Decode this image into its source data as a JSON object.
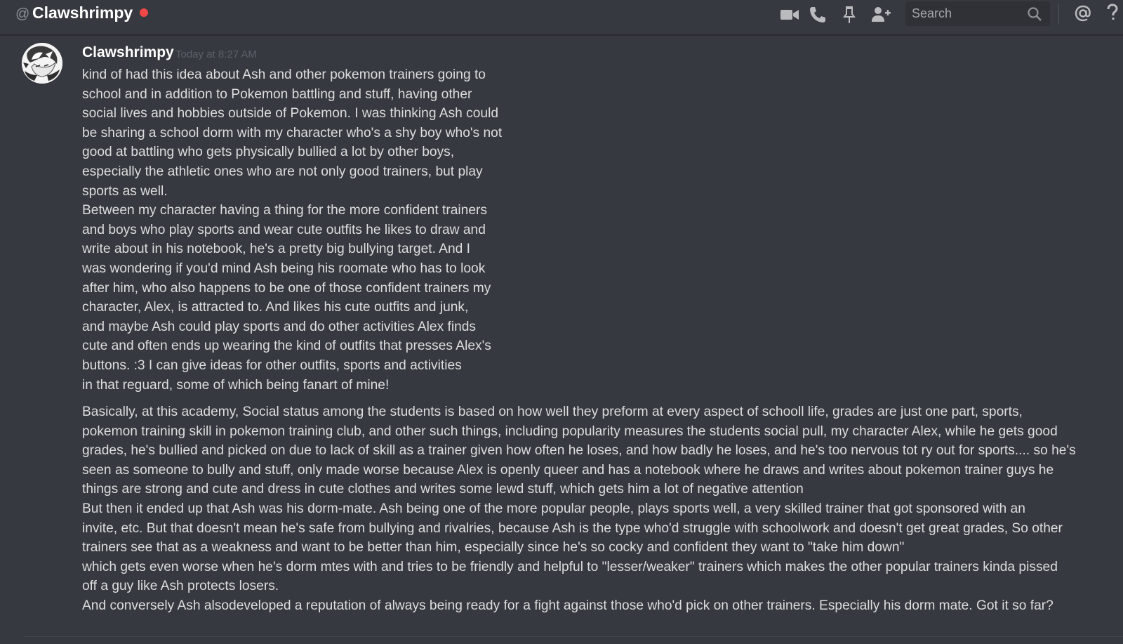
{
  "header": {
    "at_symbol": "@",
    "channel_name": "Clawshrimpy",
    "status_color": "#f04747",
    "toolbar_icons": [
      "video-call-icon",
      "voice-call-icon",
      "pin-icon",
      "add-friend-icon"
    ],
    "search": {
      "placeholder": "Search",
      "value": ""
    },
    "right_icons": [
      "mention-icon",
      "help-icon"
    ]
  },
  "message": {
    "author": "Clawshrimpy",
    "timestamp": "Today at 8:27 AM",
    "avatar": "avatar-image",
    "block1": [
      "kind of had this idea about Ash and other pokemon trainers going to",
      "school and in addition to Pokemon battling and stuff, having other",
      "social lives and hobbies outside of Pokemon. I was thinking Ash could",
      "be sharing a school dorm with my character who's a shy boy who's not",
      "good at battling who gets physically bullied a lot by other boys,",
      "especially the athletic ones who are not only good trainers, but play",
      "sports as well.",
      "Between my character having a thing for the more confident trainers",
      "and boys who play sports and wear cute outfits he likes to draw and",
      "write about in his notebook, he's a pretty big bullying target. And I",
      "was wondering if you'd mind Ash being his roomate who has to look",
      "after him, who also happens to be one of those confident trainers my",
      "character, Alex, is attracted to. And likes his cute outfits and junk,",
      "and maybe Ash could play sports and do other activities Alex finds",
      "cute and often ends up wearing the kind of outfits that presses Alex's",
      "buttons. :3 I can give ideas for other outfits, sports and activities",
      "in that reguard, some of which being fanart of mine!"
    ],
    "block2": [
      "Basically, at this academy, Social status among the students is based on how well they preform at every aspect of schooll life, grades are just one part, sports,",
      "pokemon training skill in pokemon training club, and other such things, including popularity measures the students social pull, my character Alex, while he gets good",
      "grades, he's bullied and picked on due to lack of skill as a trainer given how often he loses, and how badly he loses, and he's too nervous tot ry out for sports.... so he's",
      "seen as someone to bully and stuff, only made worse because Alex is openly queer and has a notebook where he draws and writes about pokemon trainer guys he",
      "things are strong and cute and dress in cute clothes and writes some lewd stuff, which gets him a lot of negative attention",
      "But then it ended up that Ash was his dorm-mate. Ash being one of the more popular people, plays sports well, a very skilled trainer that got sponsored with an",
      "invite, etc. But that doesn't mean he's safe from bullying and rivalries, because Ash is the type who'd struggle with schoolwork and doesn't get great grades, So other",
      "trainers see that as a weakness and want to be better than him, especially since he's so cocky and confident they want to \"take him down\"",
      "which gets even worse when he's dorm mtes with and tries to be friendly and helpful to \"lesser/weaker\" trainers which makes the other popular trainers kinda pissed",
      "off a guy like Ash protects losers.",
      "And conversely Ash alsodeveloped a reputation of always being ready for a fight against those who'd pick on other trainers. Especially his dorm mate. Got it so far?"
    ]
  }
}
